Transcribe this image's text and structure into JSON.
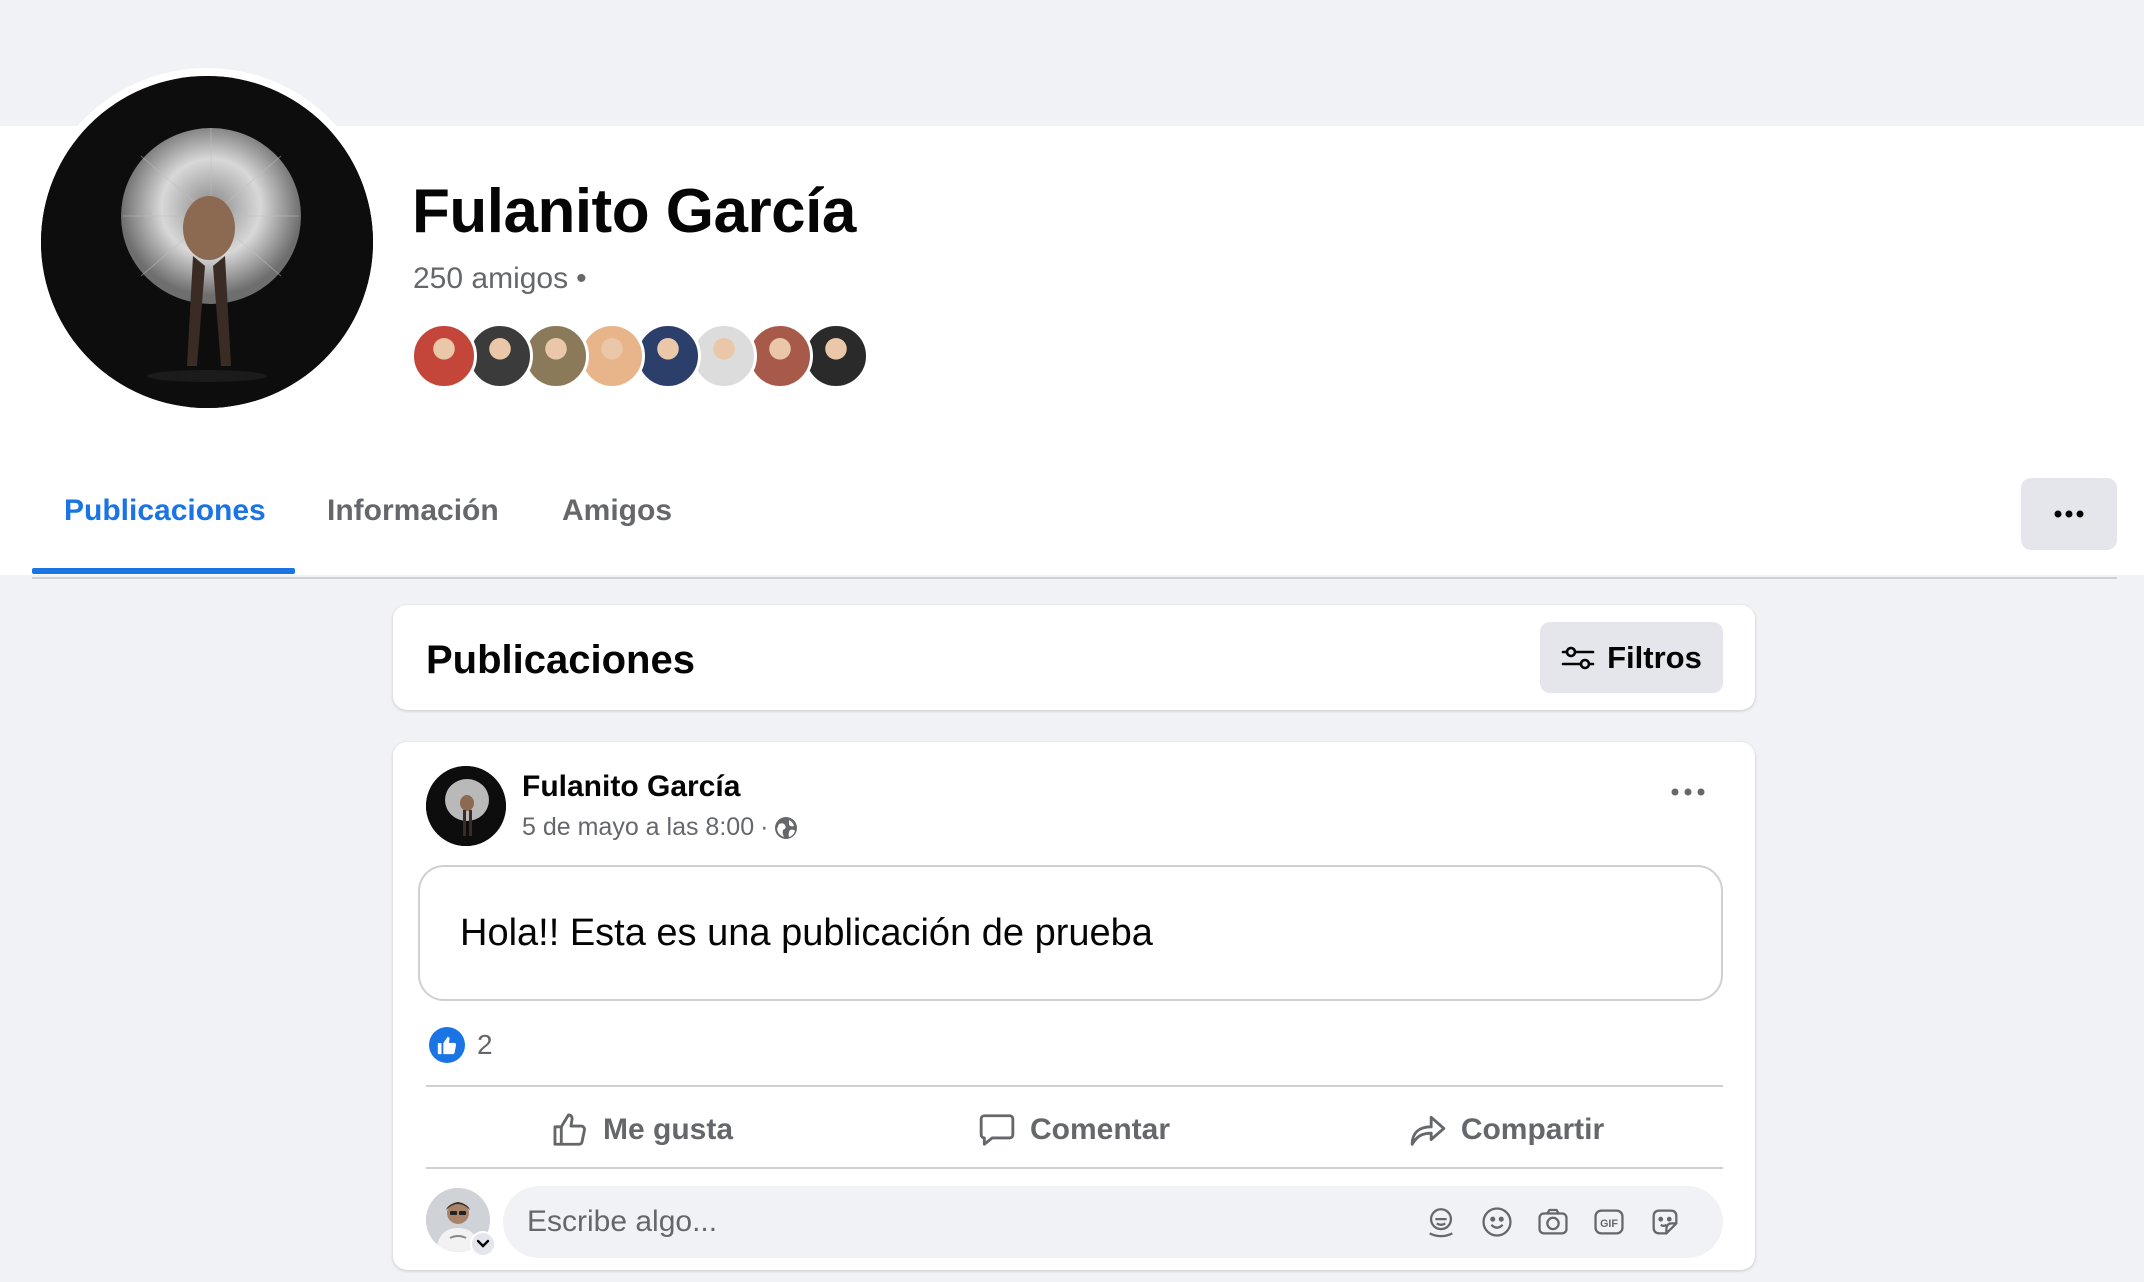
{
  "profile": {
    "name": "Fulanito García",
    "friends_count": "250 amigos",
    "friends_separator": "•",
    "friend_avatar_colors": [
      "#c4463a",
      "#3b3b3b",
      "#8a7a5a",
      "#e8b48a",
      "#2c3e6a",
      "#dcdcdc",
      "#a85a4a",
      "#2a2a2a"
    ]
  },
  "tabs": [
    {
      "label": "Publicaciones",
      "active": true
    },
    {
      "label": "Información",
      "active": false
    },
    {
      "label": "Amigos",
      "active": false
    }
  ],
  "posts_section": {
    "title": "Publicaciones",
    "filters_label": "Filtros"
  },
  "post": {
    "author": "Fulanito García",
    "timestamp": "5 de mayo a las 8:00",
    "meta_separator": "·",
    "text": "Hola!! Esta es una publicación de prueba",
    "reaction_count": "2",
    "actions": {
      "like": "Me gusta",
      "comment": "Comentar",
      "share": "Compartir"
    },
    "comment_placeholder": "Escribe algo..."
  },
  "icons": {
    "more": "more-horizontal-icon",
    "filters": "sliders-icon",
    "privacy": "globe-icon",
    "like_badge": "thumbs-up-icon",
    "like": "thumbs-up-outline-icon",
    "comment": "speech-bubble-icon",
    "share": "share-arrow-icon",
    "comment_tools": [
      "avatar-sticker-icon",
      "emoji-icon",
      "camera-icon",
      "gif-icon",
      "sticker-icon"
    ]
  },
  "colors": {
    "accent": "#1b74e4",
    "background": "#f0f2f5",
    "secondary_text": "#65676b",
    "button_gray": "#e4e6eb"
  }
}
